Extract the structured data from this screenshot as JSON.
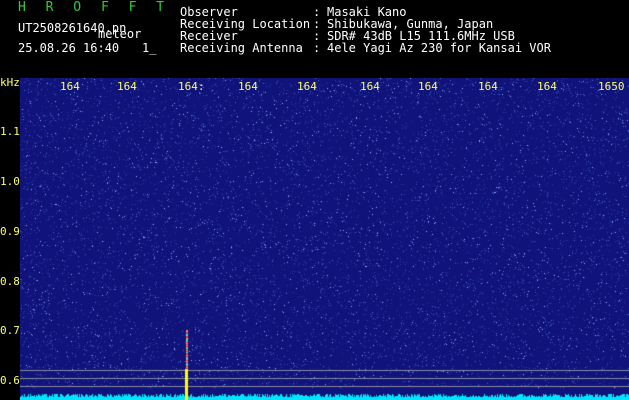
{
  "header": {
    "app_title": "H R O F F T",
    "file_name": "UT2508261640.pn",
    "meteor_label": "meteor",
    "date_time": "25.08.26 16:40",
    "count": "1_"
  },
  "info": [
    {
      "label": "Observer",
      "value": "Masaki Kano"
    },
    {
      "label": "Receiving Location",
      "value": "Shibukawa, Gunma, Japan"
    },
    {
      "label": "Receiver",
      "value": "SDR# 43dB L15 111.6MHz USB"
    },
    {
      "label": "Receiving Antenna",
      "value": "4ele Yagi Az 230 for Kansai VOR"
    }
  ],
  "separator": ":",
  "freq_axis": {
    "unit": "kHz",
    "ticks": [
      "164",
      "164",
      "164:",
      "164",
      "164",
      "164",
      "164",
      "164",
      "164",
      "1650"
    ]
  },
  "time_axis": {
    "ticks": [
      "1.1",
      "1.0",
      "0.9",
      "0.8",
      "0.7",
      "0.6"
    ]
  },
  "colors": {
    "background": "#000000",
    "waterfall": "#10147a",
    "text_green": "#33cc33",
    "text_yellow": "#ffff66",
    "spectrum_cyan": "#00e5ff",
    "echo_yellow": "#ffff00"
  }
}
